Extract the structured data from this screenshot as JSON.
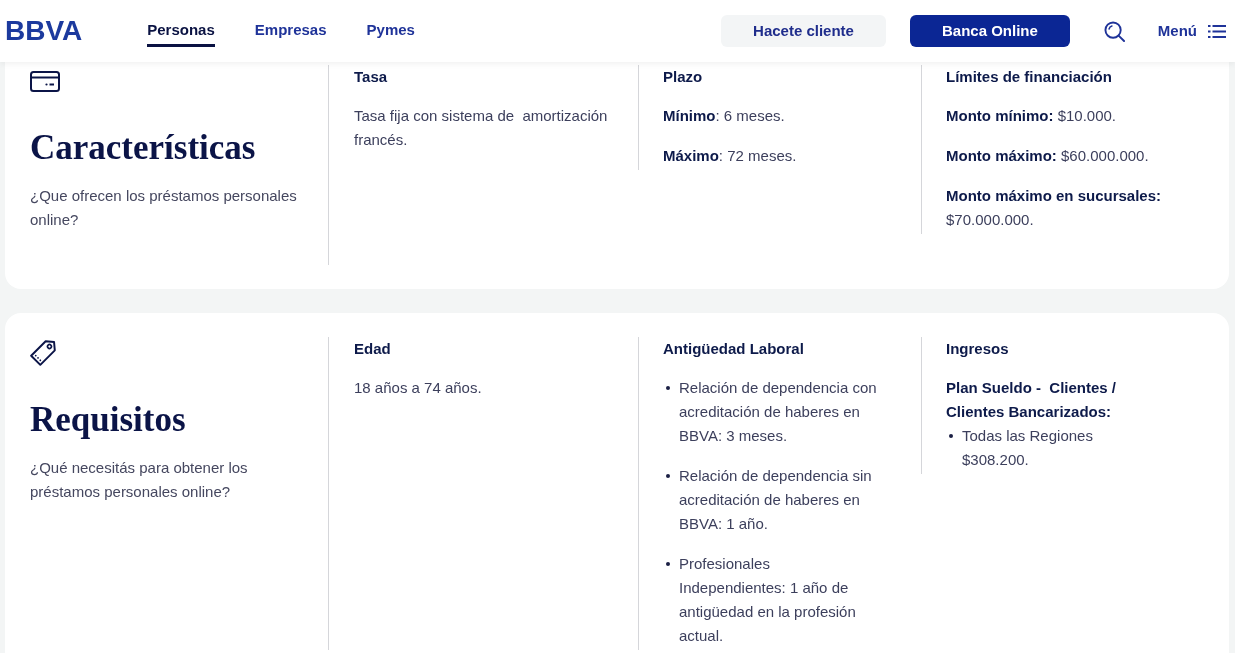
{
  "header": {
    "logo": "BBVA",
    "nav": [
      {
        "label": "Personas",
        "selected": true
      },
      {
        "label": "Empresas",
        "selected": false
      },
      {
        "label": "Pymes",
        "selected": false
      }
    ],
    "buttons": [
      {
        "label": "Hacete cliente",
        "kind": "secondary"
      },
      {
        "label": "Banca Online",
        "kind": "primary"
      }
    ],
    "menu_label": "Menú"
  },
  "sections": [
    {
      "title": "Características",
      "subtitle": "¿Que ofrecen los préstamos personales online?",
      "columns": [
        {
          "heading": "Tasa",
          "blocks": [
            {
              "kind": "paragraph",
              "text": "Tasa fija con sistema de  amortización francés."
            }
          ]
        },
        {
          "heading": "Plazo",
          "blocks": [
            {
              "kind": "paragraph",
              "text": "**Mínimo**: 6 meses."
            },
            {
              "kind": "paragraph",
              "text": "**Máximo**: 72 meses."
            }
          ]
        },
        {
          "heading": "Límites de financiación",
          "blocks": [
            {
              "kind": "paragraph",
              "text": "**Monto mínimo:** $10.000."
            },
            {
              "kind": "paragraph",
              "text": "**Monto máximo:** $60.000.000."
            },
            {
              "kind": "paragraph",
              "text": "**Monto máximo en sucursales:** $70.000.000."
            }
          ]
        }
      ]
    },
    {
      "title": "Requisitos",
      "subtitle": "¿Qué necesitás para obtener los préstamos personales online?",
      "columns": [
        {
          "heading": "Edad",
          "blocks": [
            {
              "kind": "paragraph",
              "text": "18 años a 74 años."
            }
          ]
        },
        {
          "heading": "Antigüedad Laboral",
          "blocks": [
            {
              "kind": "list",
              "items": [
                "Relación de dependencia con acreditación de haberes en BBVA: 3 meses.",
                "Relación de dependencia sin acreditación de haberes en BBVA: 1 año.",
                "Profesionales\nIndependientes: 1 año de antigüedad en la profesión actual."
              ]
            }
          ]
        },
        {
          "heading": "Ingresos",
          "blocks": [
            {
              "kind": "subheading",
              "text": "Plan Sueldo -  Clientes / Clientes Bancarizados:"
            },
            {
              "kind": "list",
              "items": [
                "Todas las Regiones\n$308.200."
              ]
            }
          ]
        }
      ]
    }
  ]
}
